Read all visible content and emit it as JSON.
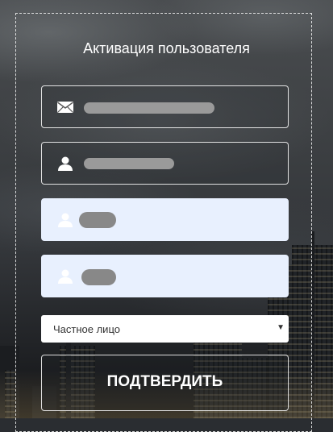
{
  "form": {
    "title": "Активация пользователя",
    "email_field": {
      "icon": "envelope-icon",
      "value": ""
    },
    "name_field": {
      "icon": "user-icon",
      "value": ""
    },
    "password_field": {
      "icon": "user-icon",
      "value": ""
    },
    "confirm_field": {
      "icon": "user-icon",
      "value": ""
    },
    "type_select": {
      "selected": "Частное лицо"
    },
    "submit_label": "ПОДТВЕРДИТЬ"
  },
  "colors": {
    "field_autofill": "#e8f0fe",
    "frame_border": "#ffffff",
    "text": "#ffffff"
  }
}
